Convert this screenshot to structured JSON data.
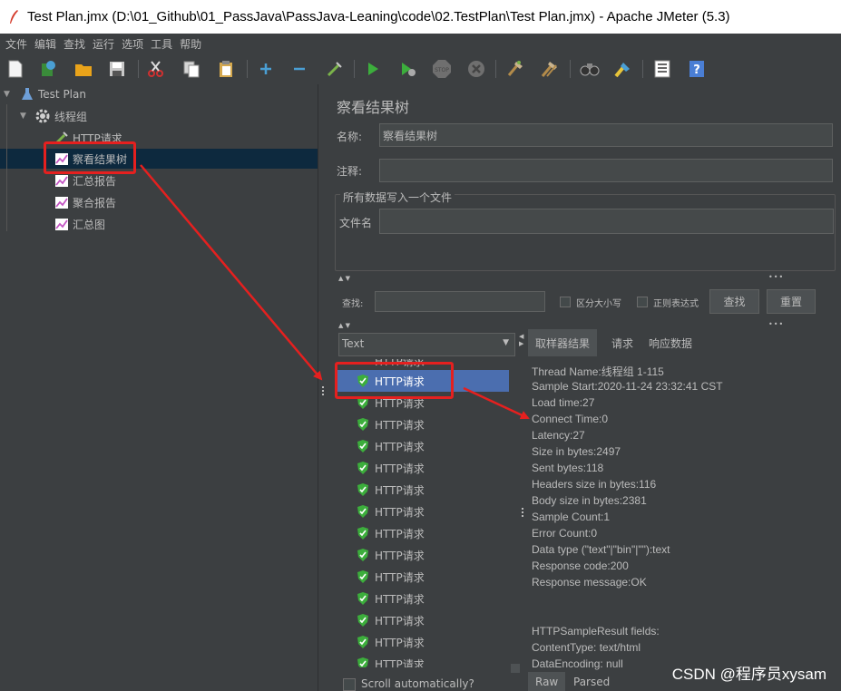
{
  "window": {
    "title": "Test Plan.jmx (D:\\01_Github\\01_PassJava\\PassJava-Leaning\\code\\02.TestPlan\\Test Plan.jmx) - Apache JMeter (5.3)"
  },
  "menu": [
    "文件",
    "编辑",
    "查找",
    "运行",
    "选项",
    "工具",
    "帮助"
  ],
  "toolbar_icons": [
    "new-icon",
    "templates-icon",
    "open-icon",
    "save-icon",
    "cut-icon",
    "copy-icon",
    "paste-icon",
    "expand-icon",
    "collapse-icon",
    "toggle-icon",
    "start-icon",
    "start-no-pause-icon",
    "stop-icon",
    "shutdown-icon",
    "clear-icon",
    "clear-all-icon",
    "search-icon",
    "reset-search-icon",
    "function-helper-icon",
    "help-icon"
  ],
  "tree": {
    "test_plan": "Test Plan",
    "thread_group": "线程组",
    "http_request": "HTTP请求",
    "view_results_tree": "察看结果树",
    "summary_report": "汇总报告",
    "aggregate_report": "聚合报告",
    "summary_graph": "汇总图"
  },
  "panel": {
    "title": "察看结果树",
    "name_label": "名称:",
    "name_value": "察看结果树",
    "comment_label": "注释:",
    "comment_value": "",
    "file_section": "所有数据写入一个文件",
    "filename_label": "文件名",
    "filename_value": ""
  },
  "search": {
    "label": "查找:",
    "value": "",
    "case_sensitive": "区分大小写",
    "regex": "正则表达式",
    "find_button": "查找",
    "reset_button": "重置"
  },
  "renderer": {
    "selected": "Text"
  },
  "results": {
    "items": [
      "HTTP请求",
      "HTTP请求",
      "HTTP请求",
      "HTTP请求",
      "HTTP请求",
      "HTTP请求",
      "HTTP请求",
      "HTTP请求",
      "HTTP请求",
      "HTTP请求",
      "HTTP请求",
      "HTTP请求",
      "HTTP请求",
      "HTTP请求",
      "HTTP请求"
    ],
    "partial_top": "HTTP请求",
    "scroll_auto": "Scroll automatically?"
  },
  "detail": {
    "tabs": [
      "取样器结果",
      "请求",
      "响应数据"
    ],
    "lines": [
      "Thread Name:线程组 1-115",
      "Sample Start:2020-11-24 23:32:41 CST",
      "Load time:27",
      "Connect Time:0",
      "Latency:27",
      "Size in bytes:2497",
      "Sent bytes:118",
      "Headers size in bytes:116",
      "Body size in bytes:2381",
      "Sample Count:1",
      "Error Count:0",
      "Data type (\"text\"|\"bin\"|\"\"):text",
      "Response code:200",
      "Response message:OK",
      "",
      "",
      "HTTPSampleResult fields:",
      "ContentType: text/html",
      "DataEncoding: null"
    ],
    "bottom_tabs": [
      "Raw",
      "Parsed"
    ]
  },
  "watermark": "CSDN @程序员xysam",
  "colors": {
    "background": "#3c3f41",
    "selection": "#4b6eaf",
    "annotation": "#e5201f"
  }
}
